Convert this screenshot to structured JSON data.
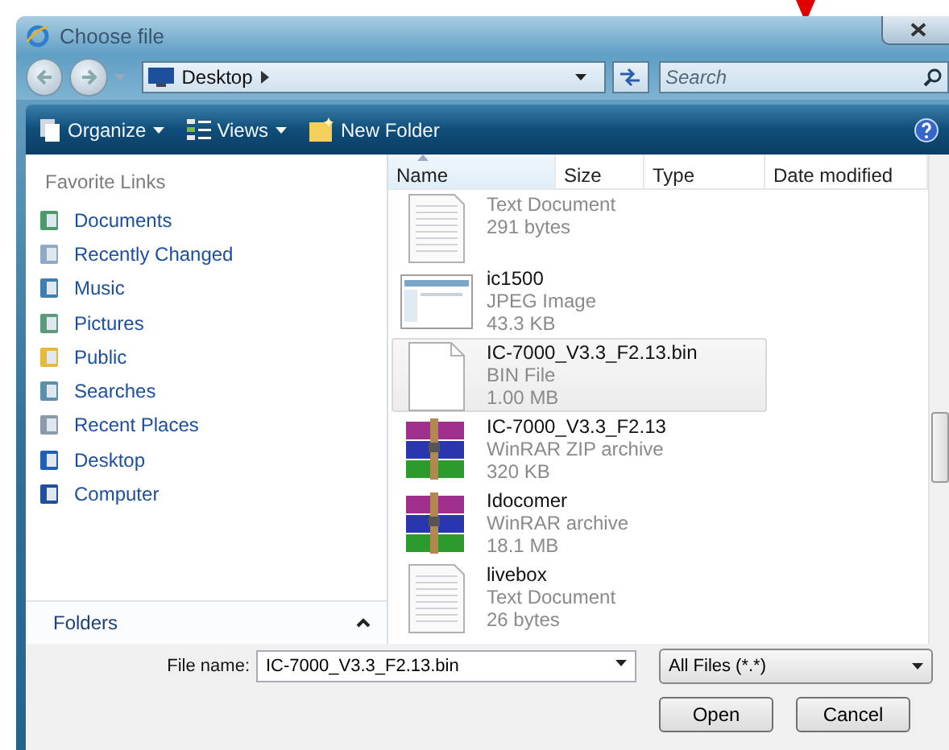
{
  "window": {
    "title": "Choose file"
  },
  "address": {
    "location": "Desktop"
  },
  "search": {
    "placeholder": "Search"
  },
  "toolbar": [
    {
      "label": "Organize",
      "dropdown": true
    },
    {
      "label": "Views",
      "dropdown": true
    },
    {
      "label": "New Folder",
      "dropdown": false
    }
  ],
  "favorite_links": {
    "title": "Favorite Links",
    "items": [
      {
        "label": "Documents"
      },
      {
        "label": "Recently Changed"
      },
      {
        "label": "Music"
      },
      {
        "label": "Pictures"
      },
      {
        "label": "Public"
      },
      {
        "label": "Searches"
      },
      {
        "label": "Recent Places"
      },
      {
        "label": "Desktop"
      },
      {
        "label": "Computer"
      }
    ]
  },
  "folders": {
    "label": "Folders"
  },
  "columns": [
    {
      "label": "Name",
      "sorted": true
    },
    {
      "label": "Size",
      "sorted": false
    },
    {
      "label": "Type",
      "sorted": false
    },
    {
      "label": "Date modified",
      "sorted": false
    }
  ],
  "files": [
    {
      "kind": "text",
      "type": "Text Document",
      "size": "291 bytes",
      "selected": false
    },
    {
      "kind": "image",
      "name": "ic1500",
      "type": "JPEG Image",
      "size": "43.3 KB",
      "selected": false
    },
    {
      "kind": "bin",
      "name": "IC-7000_V3.3_F2.13.bin",
      "type": "BIN File",
      "size": "1.00 MB",
      "selected": true
    },
    {
      "kind": "archive",
      "name": "IC-7000_V3.3_F2.13",
      "type": "WinRAR ZIP archive",
      "size": "320 KB",
      "selected": false
    },
    {
      "kind": "archive",
      "name": "Idocomer",
      "type": "WinRAR archive",
      "size": "18.1 MB",
      "selected": false
    },
    {
      "kind": "text",
      "name": "livebox",
      "type": "Text Document",
      "size": "26 bytes",
      "selected": false
    }
  ],
  "file_name": {
    "label": "File name:",
    "value": "IC-7000_V3.3_F2.13.bin"
  },
  "filter": {
    "value": "All Files (*.*)"
  },
  "buttons": [
    "Open",
    "Cancel"
  ]
}
